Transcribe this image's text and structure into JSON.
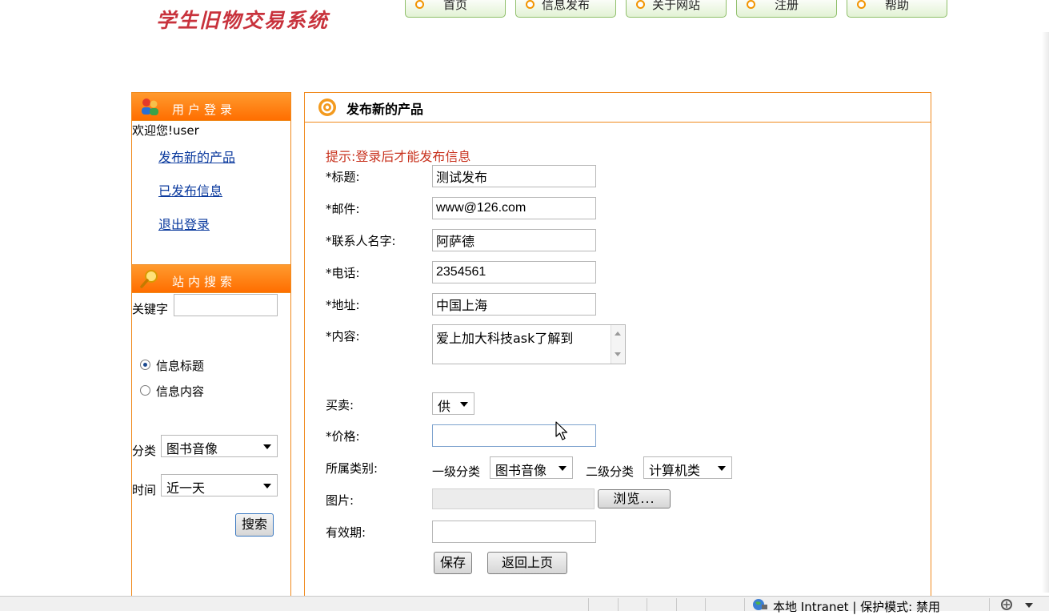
{
  "site_title": "学生旧物交易系统",
  "nav": [
    {
      "label": "首页"
    },
    {
      "label": "信息发布"
    },
    {
      "label": "关于网站"
    },
    {
      "label": "注册"
    },
    {
      "label": "帮助"
    }
  ],
  "login_box": {
    "title": "用户登录",
    "welcome": "欢迎您!user",
    "links": [
      "发布新的产品",
      "已发布信息",
      "退出登录"
    ]
  },
  "search_box": {
    "title": "站内搜索",
    "keyword_label": "关键字",
    "keyword_value": "",
    "radio_options": [
      "信息标题",
      "信息内容"
    ],
    "radio_selected": 0,
    "category_label": "分类",
    "category_value": "图书音像",
    "time_label": "时间",
    "time_value": "近一天",
    "search_button": "搜索"
  },
  "form": {
    "title": "发布新的产品",
    "hint": "提示:登录后才能发布信息",
    "title_label": "*标题:",
    "title_value": "测试发布",
    "email_label": "*邮件:",
    "email_value": "www@126.com",
    "contact_label": "*联系人名字:",
    "contact_value": "阿萨德",
    "phone_label": "*电话:",
    "phone_value": "2354561",
    "address_label": "*地址:",
    "address_value": "中国上海",
    "content_label": "*内容:",
    "content_value": "爱上加大科技ask了解到",
    "trade_label": "买卖:",
    "trade_value": "供",
    "price_label": "*价格:",
    "price_value": "",
    "category_label": "所属类别:",
    "level1_label": "一级分类",
    "level1_value": "图书音像",
    "level2_label": "二级分类",
    "level2_value": "计算机类",
    "image_label": "图片:",
    "browse_button": "浏览...",
    "validity_label": "有效期:",
    "validity_value": "",
    "save_button": "保存",
    "back_button": "返回上页"
  },
  "statusbar": {
    "zone_text": "本地 Intranet | 保护模式: 禁用"
  },
  "colors": {
    "accent_orange": "#ff7f0a",
    "link_blue": "#0b3a9e",
    "hint_red": "#c8321e",
    "logo_red": "#c8323c"
  }
}
